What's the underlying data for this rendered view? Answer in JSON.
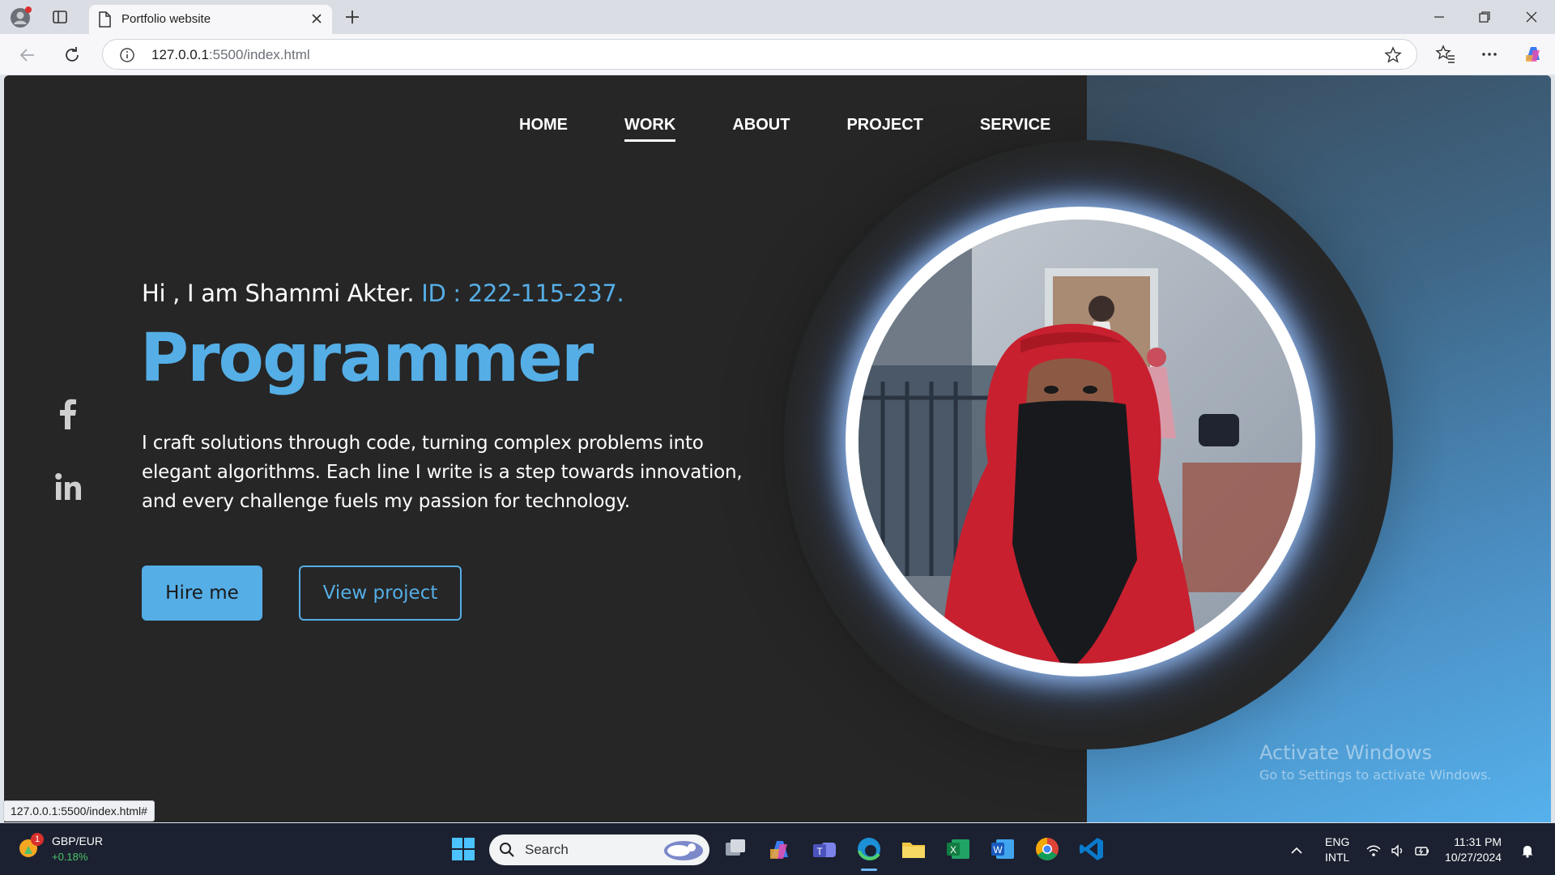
{
  "browser": {
    "tab_title": "Portfolio website",
    "url_host": "127.0.0.1",
    "url_rest": ":5500/index.html",
    "status_url": "127.0.0.1:5500/index.html#"
  },
  "nav": {
    "items": [
      {
        "label": "HOME"
      },
      {
        "label": "WORK",
        "active": true
      },
      {
        "label": "ABOUT"
      },
      {
        "label": "PROJECT"
      },
      {
        "label": "SERVICE"
      }
    ]
  },
  "hero": {
    "intro": "Hi , I am Shammi Akter. ",
    "id_text": "ID : 222-115-237.",
    "role": "Programmer",
    "description": "I craft solutions through code, turning complex problems into elegant algorithms. Each line I write is a step towards innovation, and every challenge fuels my passion for technology.",
    "hire_label": "Hire me",
    "view_label": "View project"
  },
  "social": [
    "facebook-icon",
    "linkedin-icon"
  ],
  "watermark": {
    "title": "Activate Windows",
    "subtitle": "Go to Settings to activate Windows."
  },
  "taskbar": {
    "ticker_name": "GBP/EUR",
    "ticker_change": "+0.18%",
    "ticker_badge": "1",
    "search_placeholder": "Search",
    "lang_line1": "ENG",
    "lang_line2": "INTL",
    "time": "11:31 PM",
    "date": "10/27/2024"
  },
  "colors": {
    "accent": "#55aee6",
    "page_bg": "#262626"
  }
}
